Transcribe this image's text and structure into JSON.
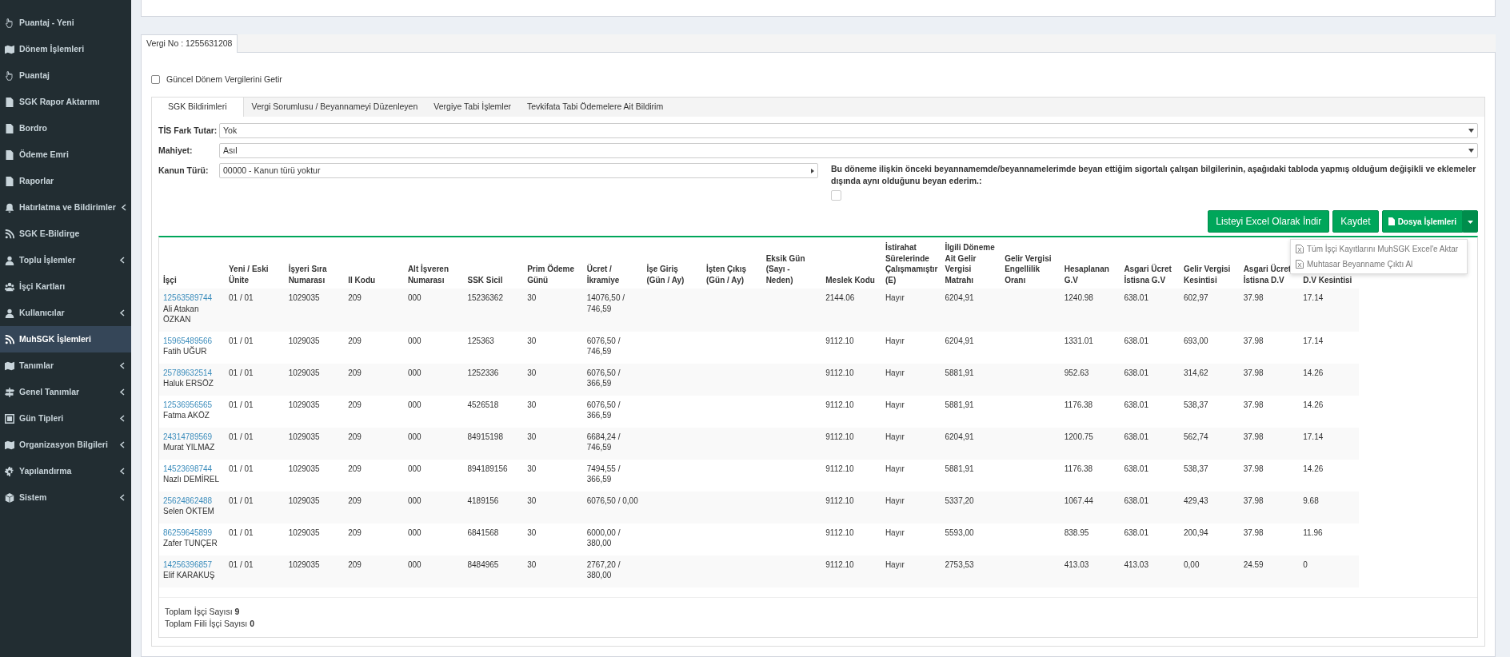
{
  "sidebar": {
    "items": [
      {
        "label": "Puantaj - Yeni",
        "kind": "hand",
        "expandable": false,
        "selected": false
      },
      {
        "label": "Dönem İşlemleri",
        "kind": "map",
        "expandable": false,
        "selected": false
      },
      {
        "label": "Puantaj",
        "kind": "hand",
        "expandable": false,
        "selected": false
      },
      {
        "label": "SGK Rapor Aktarımı",
        "kind": "file",
        "expandable": false,
        "selected": false
      },
      {
        "label": "Bordro",
        "kind": "file",
        "expandable": false,
        "selected": false
      },
      {
        "label": "Ödeme Emri",
        "kind": "file",
        "expandable": false,
        "selected": false
      },
      {
        "label": "Raporlar",
        "kind": "file",
        "expandable": false,
        "selected": false
      },
      {
        "label": "Hatırlatma ve Bildirimler",
        "kind": "bell",
        "expandable": true,
        "selected": false
      },
      {
        "label": "SGK E-Bildirge",
        "kind": "rss",
        "expandable": false,
        "selected": false
      },
      {
        "label": "Toplu İşlemler",
        "kind": "user",
        "expandable": true,
        "selected": false
      },
      {
        "label": "İşçi Kartları",
        "kind": "users",
        "expandable": false,
        "selected": false
      },
      {
        "label": "Kullanıcılar",
        "kind": "user",
        "expandable": true,
        "selected": false
      },
      {
        "label": "MuhSGK İşlemleri",
        "kind": "rss",
        "expandable": false,
        "selected": true
      },
      {
        "label": "Tanımlar",
        "kind": "map",
        "expandable": true,
        "selected": false
      },
      {
        "label": "Genel Tanımlar",
        "kind": "signs",
        "expandable": true,
        "selected": false
      },
      {
        "label": "Gün Tipleri",
        "kind": "frame",
        "expandable": true,
        "selected": false
      },
      {
        "label": "Organizasyon Bilgileri",
        "kind": "map",
        "expandable": true,
        "selected": false
      },
      {
        "label": "Yapılandırma",
        "kind": "gear",
        "expandable": true,
        "selected": false
      },
      {
        "label": "Sistem",
        "kind": "cube",
        "expandable": true,
        "selected": false
      }
    ]
  },
  "outer_tabs": [
    {
      "label": "Vergi No : 1255631208",
      "selected": true
    }
  ],
  "current_taxes": {
    "label": "Güncel Dönem Vergilerini Getir",
    "checked": false
  },
  "tabs": [
    {
      "label": "SGK Bildirimleri",
      "selected": true
    },
    {
      "label": "Vergi Sorumlusu / Beyannameyi Düzenleyen",
      "selected": false
    },
    {
      "label": "Vergiye Tabi İşlemler",
      "selected": false
    },
    {
      "label": "Tevkifata Tabi Ödemelere Ait Bildirim",
      "selected": false
    }
  ],
  "form": {
    "fields": [
      {
        "label": "TİS Fark Tutar:",
        "value": "Yok",
        "kind": "select"
      },
      {
        "label": "Mahiyet:",
        "value": "Asıl",
        "kind": "select"
      },
      {
        "label": "Kanun Türü:",
        "value": "00000 - Kanun türü yoktur",
        "kind": "picker"
      }
    ],
    "declaration": {
      "text": "Bu döneme ilişkin önceki beyannamemde/beyannamelerimde beyan ettiğim sigortalı çalışan bilgilerinin, aşağıdaki tabloda yapmış olduğum değişikli ve eklemeler dışında aynı olduğunu beyan ederim.:",
      "checked": false
    }
  },
  "buttons": [
    {
      "label": "Listeyi Excel Olarak İndir",
      "kind": "plain"
    },
    {
      "label": "Kaydet",
      "kind": "plain"
    },
    {
      "label": "Dosya İşlemleri",
      "kind": "split"
    }
  ],
  "file_menu": {
    "items": [
      "Tüm İşçi Kayıtlarını MuhSGK Excel'e Aktar",
      "Muhtasar Beyanname Çıktı Al"
    ]
  },
  "table": {
    "worker_header": "İşçi",
    "columns": [
      "Yeni / Eski Ünite",
      "İşyeri Sıra Numarası",
      "Il Kodu",
      "Alt İşveren Numarası",
      "SSK Sicil",
      "Prim Ödeme Günü",
      "Ücret / İkramiye",
      "İşe Giriş (Gün / Ay)",
      "İşten Çıkış (Gün / Ay)",
      "Eksik Gün (Sayı - Neden)",
      "Meslek Kodu",
      "İstirahat Sürelerinde Çalışmamıştır (E)",
      "İlgili Döneme Ait Gelir Vergisi Matrahı",
      "Gelir Vergisi Engellilik Oranı",
      "Hesaplanan G.V",
      "Asgari Ücret İstisna G.V",
      "Gelir Vergisi Kesintisi",
      "Asgari Ücret İstisna D.V",
      "D.V Kesintisi"
    ],
    "rows": [
      {
        "id": "12563589744",
        "name": "Ali Atakan ÖZKAN",
        "cells": [
          "01 / 01",
          "1029035",
          "209",
          "000",
          "15236362",
          "30",
          "14076,50 / 746,59",
          "",
          "",
          "",
          "2144.06",
          "Hayır",
          "6204,91",
          "",
          "1240.98",
          "638.01",
          "602,97",
          "37.98",
          "17.14"
        ]
      },
      {
        "id": "15965489566",
        "name": "Fatih UĞUR",
        "cells": [
          "01 / 01",
          "1029035",
          "209",
          "000",
          "125363",
          "30",
          "6076,50 / 746,59",
          "",
          "",
          "",
          "9112.10",
          "Hayır",
          "6204,91",
          "",
          "1331.01",
          "638.01",
          "693,00",
          "37.98",
          "17.14"
        ]
      },
      {
        "id": "25789632514",
        "name": "Haluk ERSÖZ",
        "cells": [
          "01 / 01",
          "1029035",
          "209",
          "000",
          "1252336",
          "30",
          "6076,50 / 366,59",
          "",
          "",
          "",
          "9112.10",
          "Hayır",
          "5881,91",
          "",
          "952.63",
          "638.01",
          "314,62",
          "37.98",
          "14.26"
        ]
      },
      {
        "id": "12536956565",
        "name": "Fatma AKÖZ",
        "cells": [
          "01 / 01",
          "1029035",
          "209",
          "000",
          "4526518",
          "30",
          "6076,50 / 366,59",
          "",
          "",
          "",
          "9112.10",
          "Hayır",
          "5881,91",
          "",
          "1176.38",
          "638.01",
          "538,37",
          "37.98",
          "14.26"
        ]
      },
      {
        "id": "24314789569",
        "name": "Murat YILMAZ",
        "cells": [
          "01 / 01",
          "1029035",
          "209",
          "000",
          "84915198",
          "30",
          "6684,24 / 746,59",
          "",
          "",
          "",
          "9112.10",
          "Hayır",
          "6204,91",
          "",
          "1200.75",
          "638.01",
          "562,74",
          "37.98",
          "17.14"
        ]
      },
      {
        "id": "14523698744",
        "name": "Nazlı DEMİREL",
        "cells": [
          "01 / 01",
          "1029035",
          "209",
          "000",
          "894189156",
          "30",
          "7494,55 / 366,59",
          "",
          "",
          "",
          "9112.10",
          "Hayır",
          "5881,91",
          "",
          "1176.38",
          "638.01",
          "538,37",
          "37.98",
          "14.26"
        ]
      },
      {
        "id": "25624862488",
        "name": "Selen ÖKTEM",
        "cells": [
          "01 / 01",
          "1029035",
          "209",
          "000",
          "4189156",
          "30",
          "6076,50 / 0,00",
          "",
          "",
          "",
          "9112.10",
          "Hayır",
          "5337,20",
          "",
          "1067.44",
          "638.01",
          "429,43",
          "37.98",
          "9.68"
        ]
      },
      {
        "id": "86259645899",
        "name": "Zafer TUNÇER",
        "cells": [
          "01 / 01",
          "1029035",
          "209",
          "000",
          "6841568",
          "30",
          "6000,00 / 380,00",
          "",
          "",
          "",
          "9112.10",
          "Hayır",
          "5593,00",
          "",
          "838.95",
          "638.01",
          "200,94",
          "37.98",
          "11.96"
        ]
      },
      {
        "id": "14256396857",
        "name": "Elif KARAKUŞ",
        "cells": [
          "01 / 01",
          "1029035",
          "209",
          "000",
          "8484965",
          "30",
          "2767,20 / 380,00",
          "",
          "",
          "",
          "9112.10",
          "Hayır",
          "2753,53",
          "",
          "413.03",
          "413.03",
          "0,00",
          "24.59",
          "0"
        ]
      }
    ]
  },
  "summary": [
    "Toplam İşçi Sayısı **9**",
    "Toplam Fiili İşçi Sayısı **0**"
  ]
}
